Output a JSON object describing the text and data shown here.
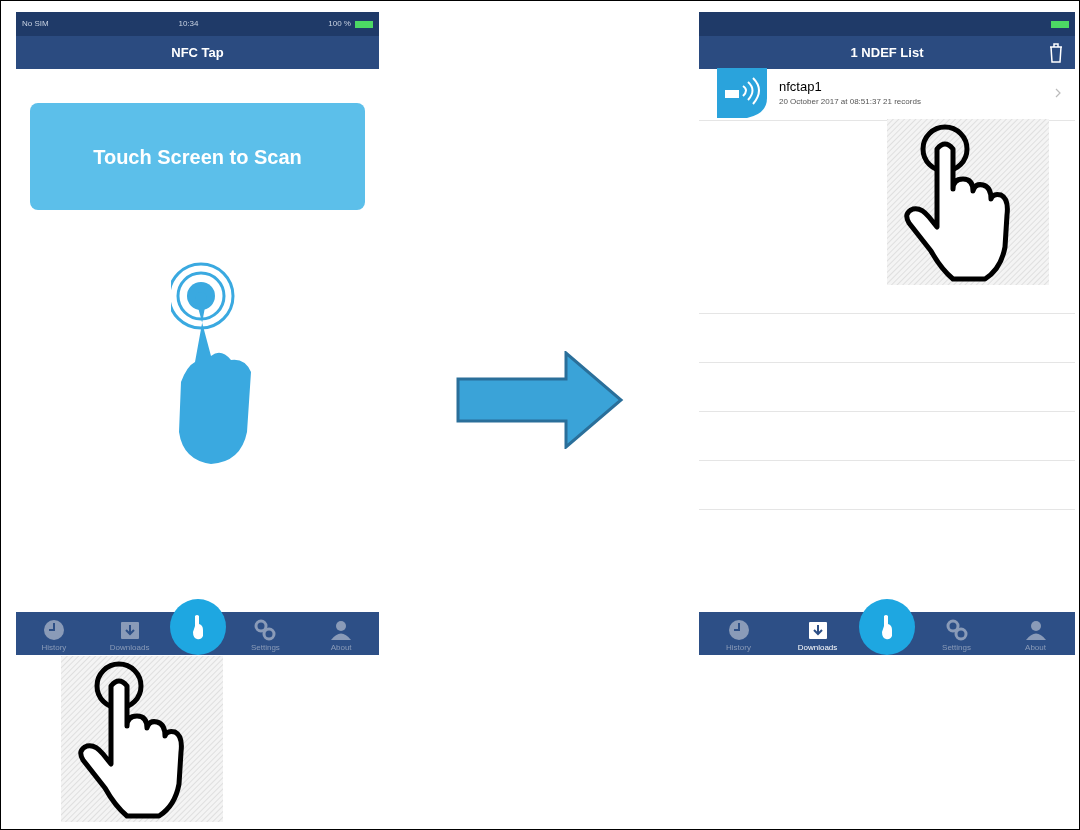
{
  "screens": [
    {
      "kind": "scan",
      "status_bar": {
        "carrier": "No SIM",
        "time": "10:34",
        "battery": "100 %"
      },
      "title": "NFC Tap",
      "scan_button": "Touch Screen to Scan",
      "tabs": [
        {
          "label": "History",
          "selected": false
        },
        {
          "label": "Downloads",
          "selected": false
        },
        {
          "label": "Settings",
          "selected": false
        },
        {
          "label": "About",
          "selected": false
        }
      ]
    },
    {
      "kind": "list",
      "title": "1 NDEF List",
      "items": [
        {
          "name": "nfctap1",
          "detail": "20 October 2017 at 08:51:37 21 records"
        }
      ],
      "tabs": [
        {
          "label": "History",
          "selected": false
        },
        {
          "label": "Downloads",
          "selected": true
        },
        {
          "label": "Settings",
          "selected": false
        },
        {
          "label": "About",
          "selected": false
        }
      ]
    }
  ]
}
